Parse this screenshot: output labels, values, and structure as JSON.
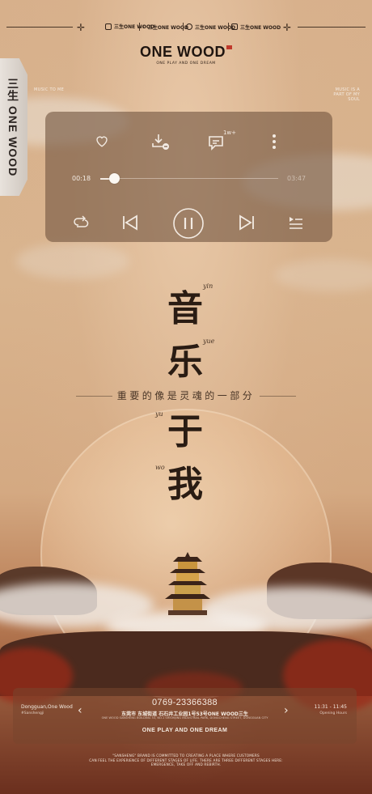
{
  "header": {
    "social": [
      {
        "icon": "brand-logo-icon",
        "label": "三生ONE WOOD"
      },
      {
        "icon": "douyin-icon",
        "label": "三生ONE WOOD"
      },
      {
        "icon": "wechat-icon",
        "label": "三生ONE WOOD"
      },
      {
        "icon": "camera-icon",
        "label": "三生ONE WOOD"
      }
    ],
    "logo": "ONE WOOD",
    "tagline": "ONE PLAY AND ONE DREAM"
  },
  "side_tab": {
    "label": "三生 ONE WOOD"
  },
  "corner_notes": {
    "left": "MUSIC TO ME",
    "right": "MUSIC IS A PART OF MY SOUL"
  },
  "player": {
    "comment_badge": "1w+",
    "current_time": "00:18",
    "total_time": "03:47",
    "progress": 0.08,
    "icons": [
      "heart-icon",
      "download-icon",
      "comment-icon",
      "more-icon",
      "repeat-icon",
      "previous-icon",
      "pause-icon",
      "next-icon",
      "playlist-icon"
    ]
  },
  "title": {
    "chars": [
      {
        "char": "音",
        "pinyin": "yin"
      },
      {
        "char": "乐",
        "pinyin": "yue"
      },
      {
        "char": "于",
        "pinyin": "yu"
      },
      {
        "char": "我",
        "pinyin": "wo"
      }
    ],
    "subtitle": "重要的像是灵魂的一部分"
  },
  "info": {
    "left_line1": "Dongguan,One Wood",
    "left_line2": "#Sanshengji",
    "phone": "0769-23366388",
    "address": "东莞市 东城街道 石石井工业园1号53号ONE WOOD三生",
    "address_en": "ONE WOOD SANSHENG BUILDING 53, NO.1 SHISHIJING INDUSTRIAL PARK, DONGCHENG STREET, DONGGUAN CITY",
    "motto": "ONE PLAY AND ONE DREAM",
    "right_line1": "11:31 - 11:45",
    "right_line2": "Opening Hours"
  },
  "footnote": {
    "line1": "\"SANSHENG\" BRAND IS COMMITTED TO CREATING A PLACE WHERE CUSTOMERS",
    "line2": "CAN FEEL THE EXPERIENCE OF DIFFERENT STAGES OF LIFE. THERE ARE THREE DIFFERENT STAGES HERE:",
    "line3": "EMERGENCE, TAKE OFF AND REBIRTH."
  }
}
